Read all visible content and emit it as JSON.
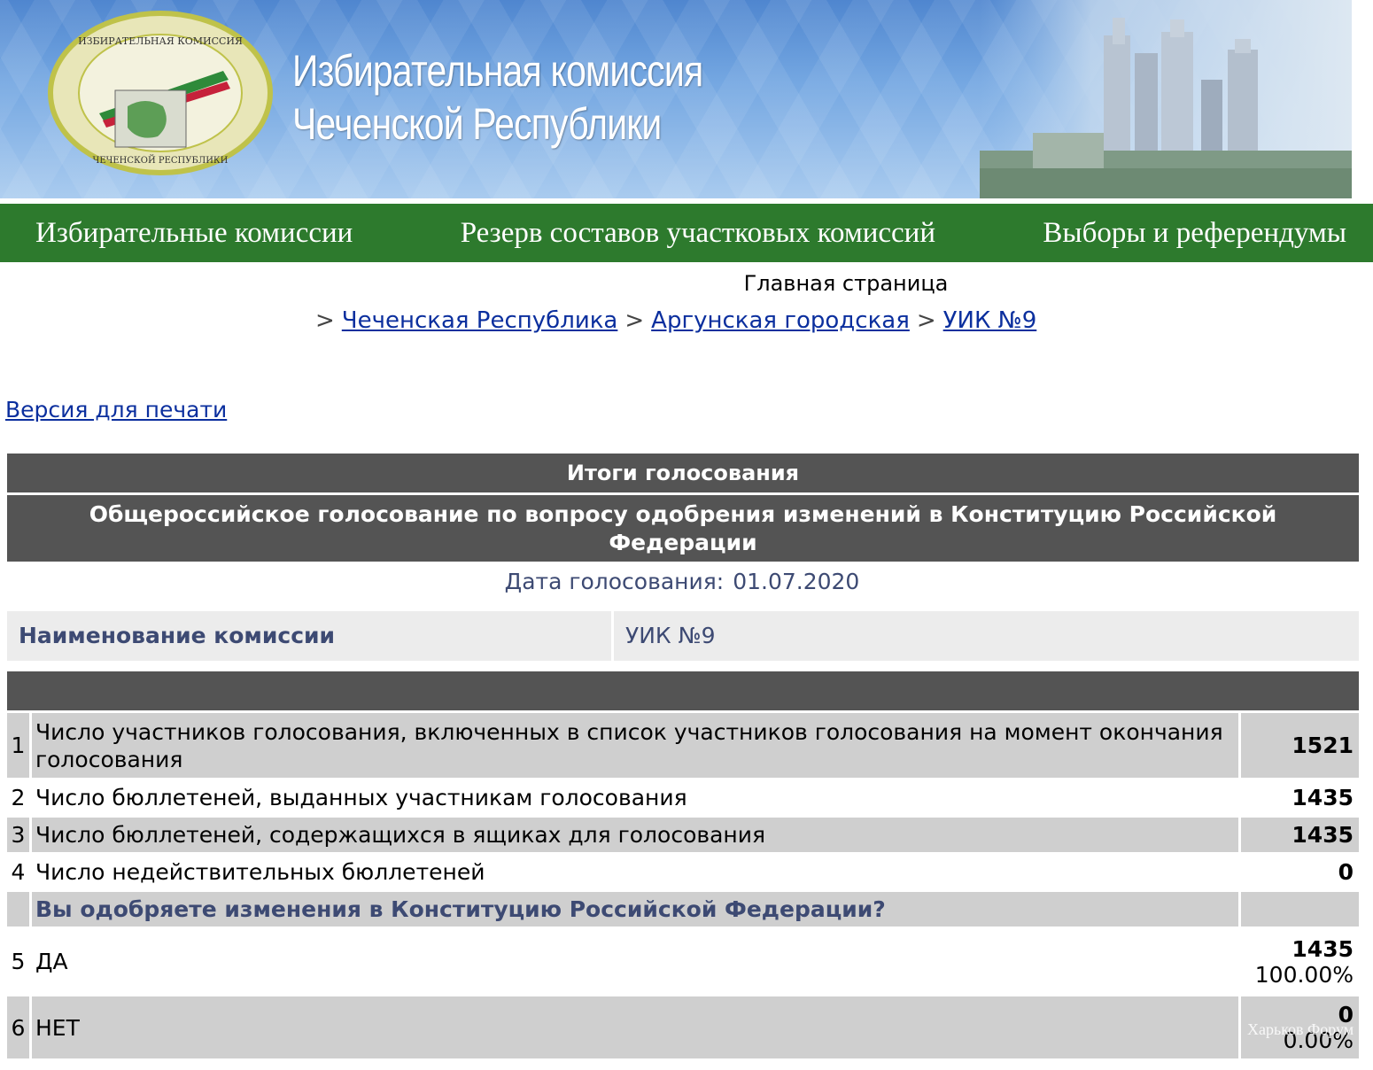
{
  "banner": {
    "title_line1": "Избирательная комиссия",
    "title_line2": "Чеченской Республики",
    "emblem_text_top": "ИЗБИРАТЕЛЬНАЯ КОМИССИЯ",
    "emblem_text_bottom": "ЧЕЧЕНСКОЙ РЕСПУБЛИКИ"
  },
  "nav": {
    "items": [
      {
        "label": "Избирательные комиссии"
      },
      {
        "label": "Резерв составов участковых комиссий"
      },
      {
        "label": "Выборы и референдумы"
      }
    ]
  },
  "home_link": "Главная страница",
  "breadcrumb": {
    "sep": ">",
    "items": [
      {
        "label": "Чеченская Республика"
      },
      {
        "label": "Аргунская городская"
      },
      {
        "label": "УИК №9"
      }
    ]
  },
  "print_link": "Версия для печати",
  "results": {
    "header": "Итоги голосования",
    "election_title": "Общероссийское голосование по вопросу одобрения изменений в Конституцию Российской Федерации",
    "date_label": "Дата голосования:",
    "date_value": "01.07.2020",
    "commission_label": "Наименование комиссии",
    "commission_value": "УИК №9",
    "rows": [
      {
        "num": "1",
        "text": "Число участников голосования, включенных в список участников голосования на момент окончания голосования",
        "value": "1521"
      },
      {
        "num": "2",
        "text": "Число бюллетеней, выданных участникам голосования",
        "value": "1435"
      },
      {
        "num": "3",
        "text": "Число бюллетеней, содержащихся в ящиках для голосования",
        "value": "1435"
      },
      {
        "num": "4",
        "text": "Число недействительных бюллетеней",
        "value": "0"
      }
    ],
    "question": "Вы одобряете изменения в Конституцию Российской Федерации?",
    "answers": [
      {
        "num": "5",
        "text": "ДА",
        "value": "1435",
        "percent": "100.00%"
      },
      {
        "num": "6",
        "text": "НЕТ",
        "value": "0",
        "percent": "0.00%"
      }
    ]
  },
  "watermark": "Харьков Форум",
  "colors": {
    "nav_green": "#2d7a2d",
    "header_grey": "#545454",
    "link_blue": "#0b2f9e",
    "label_navy": "#3d4a73"
  }
}
